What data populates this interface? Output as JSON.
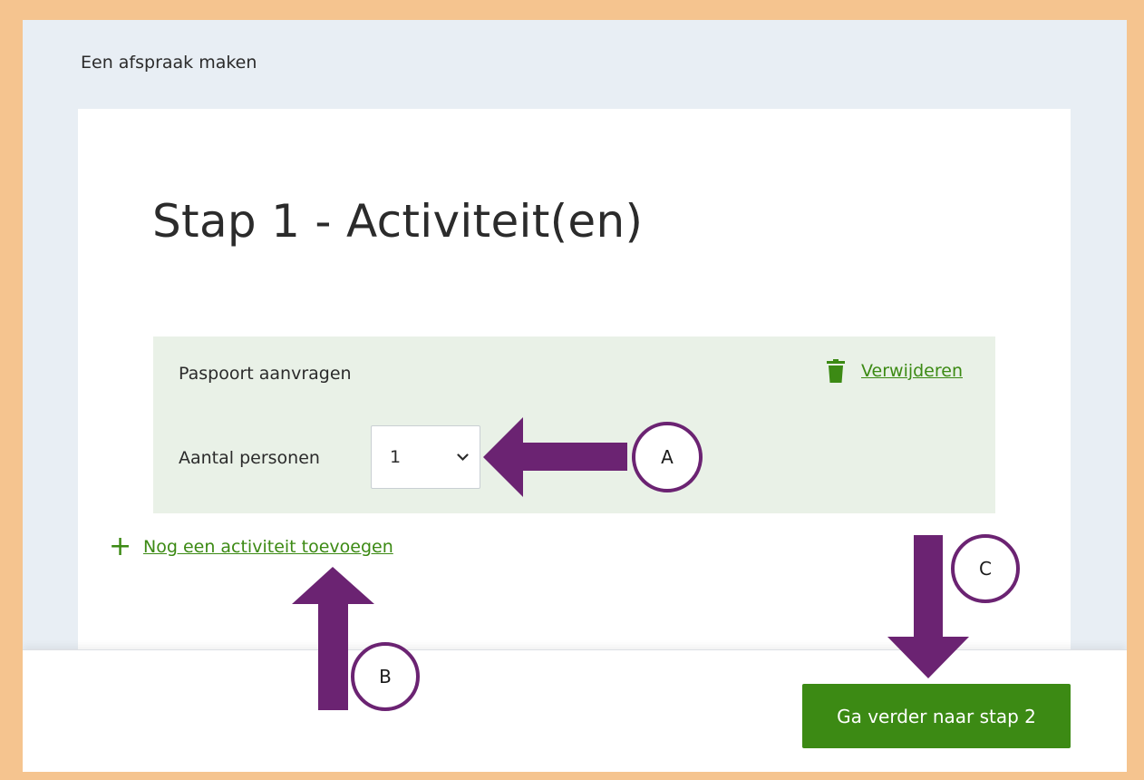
{
  "breadcrumb": "Een afspraak maken",
  "page_title": "Stap 1 - Activiteit(en)",
  "activity": {
    "name": "Paspoort aanvragen",
    "delete_label": "Verwijderen",
    "persons_label": "Aantal personen",
    "persons_value": "1"
  },
  "add_activity": {
    "icon": "+",
    "label": "Nog een activiteit toevoegen"
  },
  "next_button": "Ga verder naar stap 2",
  "annotations": {
    "a": "A",
    "b": "B",
    "c": "C"
  },
  "colors": {
    "accent_green": "#3c8a14",
    "panel_green": "#e9f1e7",
    "annotation_purple": "#6b2372",
    "frame_orange": "#f5c48f"
  }
}
